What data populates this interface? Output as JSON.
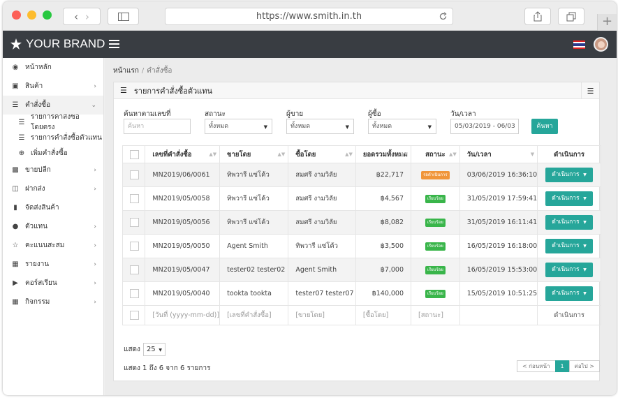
{
  "browser": {
    "url": "https://www.smith.in.th"
  },
  "topbar": {
    "brand": "YOUR BRAND"
  },
  "sidebar": {
    "items": [
      {
        "label": "หน้าหลัก",
        "icon": "dashboard-icon",
        "chev": false
      },
      {
        "label": "สินค้า",
        "icon": "cubes-icon",
        "chev": true
      },
      {
        "label": "คำสั่งซื้อ",
        "icon": "list-icon",
        "chev": true,
        "active": true
      },
      {
        "label": "ขายปลีก",
        "icon": "basket-icon",
        "chev": true
      },
      {
        "label": "ฝากส่ง",
        "icon": "cart-icon",
        "chev": true
      },
      {
        "label": "จัดส่งสินค้า",
        "icon": "truck-icon",
        "chev": false
      },
      {
        "label": "ตัวแทน",
        "icon": "users-icon",
        "chev": true
      },
      {
        "label": "คะแนนสะสม",
        "icon": "trophy-icon",
        "chev": true
      },
      {
        "label": "รายงาน",
        "icon": "bar-chart-icon",
        "chev": true
      },
      {
        "label": "คอร์สเรียน",
        "icon": "play-circle-icon",
        "chev": true
      },
      {
        "label": "กิจกรรม",
        "icon": "calendar-icon",
        "chev": true
      }
    ],
    "subitems": [
      {
        "label": "รายการคำสั่งซื้อโดยตรง"
      },
      {
        "label": "รายการคำสั่งซื้อตัวแทน"
      },
      {
        "label": "เพิ่มคำสั่งซื้อ"
      }
    ]
  },
  "breadcrumb": {
    "home": "หน้าแรก",
    "current": "คำสั่งซื้อ"
  },
  "panel": {
    "title": "รายการคำสั่งซื้อตัวแทน"
  },
  "filters": {
    "order_label": "ค้นหาตามเลขที่",
    "order_placeholder": "ค้นหา",
    "status_label": "สถานะ",
    "status_value": "ทั้งหมด",
    "seller_label": "ผู้ขาย",
    "seller_value": "ทั้งหมด",
    "buyer_label": "ผู้ซื้อ",
    "buyer_value": "ทั้งหมด",
    "date_label": "วัน/เวลา",
    "date_value": "05/03/2019 - 06/03",
    "search_button": "ค้นหา"
  },
  "table": {
    "headers": [
      "เลขที่คำสั่งซื้อ",
      "ขายโดย",
      "ซื้อโดย",
      "ยอดรวมทั้งหมด",
      "สถานะ",
      "วัน/เวลา",
      "ดำเนินการ"
    ],
    "rows": [
      {
        "order": "MN2019/06/0061",
        "seller": "ทิพวารี แซ่โค้ว",
        "buyer": "สมศรี งามวิลัย",
        "total": "฿22,717",
        "status": "รอดำเนินการ",
        "status_color": "#f0953a",
        "datetime": "03/06/2019 16:36:10",
        "action": "ดำเนินการ"
      },
      {
        "order": "MN2019/05/0058",
        "seller": "ทิพวารี แซ่โค้ว",
        "buyer": "สมศรี งามวิลัย",
        "total": "฿4,567",
        "status": "เรียบร้อย",
        "status_color": "#39b54a",
        "datetime": "31/05/2019 17:59:41",
        "action": "ดำเนินการ"
      },
      {
        "order": "MN2019/05/0056",
        "seller": "ทิพวารี แซ่โค้ว",
        "buyer": "สมศรี งามวิลัย",
        "total": "฿8,082",
        "status": "เรียบร้อย",
        "status_color": "#39b54a",
        "datetime": "31/05/2019 16:11:41",
        "action": "ดำเนินการ"
      },
      {
        "order": "MN2019/05/0050",
        "seller": "Agent Smith",
        "buyer": "ทิพวารี แซ่โค้ว",
        "total": "฿3,500",
        "status": "เรียบร้อย",
        "status_color": "#39b54a",
        "datetime": "16/05/2019 16:18:00",
        "action": "ดำเนินการ"
      },
      {
        "order": "MN2019/05/0047",
        "seller": "tester02 tester02",
        "buyer": "Agent Smith",
        "total": "฿7,000",
        "status": "เรียบร้อย",
        "status_color": "#39b54a",
        "datetime": "16/05/2019 15:53:00",
        "action": "ดำเนินการ"
      },
      {
        "order": "MN2019/05/0040",
        "seller": "tookta tookta",
        "buyer": "tester07 tester07",
        "total": "฿140,000",
        "status": "เรียบร้อย",
        "status_color": "#39b54a",
        "datetime": "15/05/2019 10:51:25",
        "action": "ดำเนินการ"
      }
    ],
    "footer": [
      "[วันที่ (yyyy-mm-dd)]",
      "[เลขที่คำสั่งซื้อ]",
      "[ขายโดย]",
      "[ซื้อโดย]",
      "[สถานะ]",
      "",
      "ดำเนินการ"
    ]
  },
  "pagination": {
    "show_label": "แสดง",
    "page_size": "25",
    "summary": "แสดง 1 ถึง 6 จาก 6 รายการ",
    "prev": "< ก่อนหน้า",
    "current": "1",
    "next": "ต่อไป >"
  },
  "colors": {
    "accent": "#26a69a",
    "topbar": "#393d42"
  }
}
